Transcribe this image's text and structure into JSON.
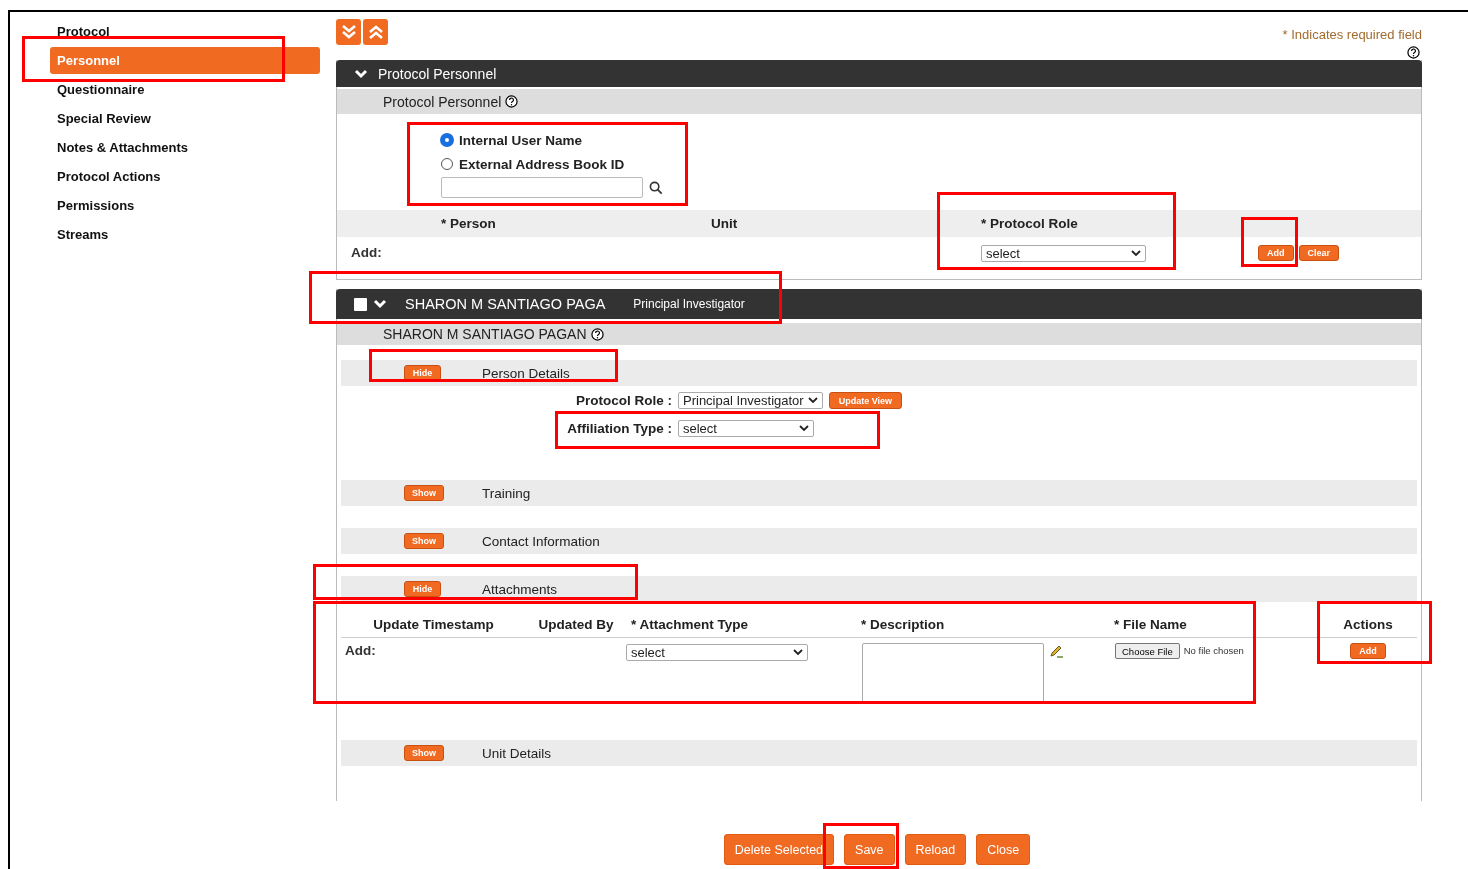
{
  "sidebar": {
    "items": [
      {
        "label": "Protocol",
        "selected": false
      },
      {
        "label": "Personnel",
        "selected": true
      },
      {
        "label": "Questionnaire",
        "selected": false
      },
      {
        "label": "Special Review",
        "selected": false
      },
      {
        "label": "Notes & Attachments",
        "selected": false
      },
      {
        "label": "Protocol Actions",
        "selected": false
      },
      {
        "label": "Permissions",
        "selected": false
      },
      {
        "label": "Streams",
        "selected": false
      }
    ]
  },
  "required_note": "* Indicates required field",
  "personnel_panel": {
    "title": "Protocol Personnel",
    "subheader": "Protocol Personnel",
    "lookup_options": [
      {
        "label": "Internal User Name",
        "selected": true
      },
      {
        "label": "External Address Book ID",
        "selected": false
      }
    ],
    "columns": [
      "* Person",
      "Unit",
      "* Protocol Role"
    ],
    "add_label": "Add:",
    "role_select": "select",
    "buttons": [
      "Add",
      "Clear"
    ]
  },
  "person": {
    "checked": false,
    "expanded": true,
    "name": "SHARON M SANTIAGO PAGA",
    "role": "Principal Investigator",
    "subheader": "SHARON M SANTIAGO PAGAN",
    "sections": [
      {
        "kind": "details",
        "title": "Person Details",
        "toggle": "Hide",
        "expanded": true,
        "fields": [
          {
            "label": "Protocol Role :",
            "value": "Principal Investigator",
            "button": "Update View"
          },
          {
            "label": "Affiliation Type :",
            "value": "select"
          }
        ]
      },
      {
        "kind": "plain",
        "title": "Training",
        "toggle": "Show",
        "expanded": false
      },
      {
        "kind": "plain",
        "title": "Contact Information",
        "toggle": "Show",
        "expanded": false
      },
      {
        "kind": "attachments",
        "title": "Attachments",
        "toggle": "Hide",
        "expanded": true,
        "columns": [
          "Update Timestamp",
          "Updated By",
          "* Attachment Type",
          "* Description",
          "* File Name",
          "Actions"
        ],
        "add_label": "Add:",
        "type_select": "select",
        "file_button": "Choose File",
        "file_status": "No file chosen",
        "add_button": "Add"
      },
      {
        "kind": "plain",
        "title": "Unit Details",
        "toggle": "Show",
        "expanded": false
      }
    ]
  },
  "footer_buttons": [
    "Delete Selected",
    "Save",
    "Reload",
    "Close"
  ]
}
